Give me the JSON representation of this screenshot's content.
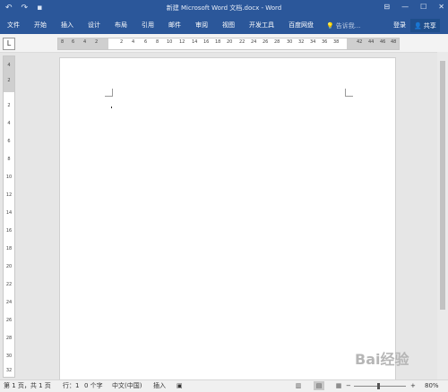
{
  "window": {
    "title": "新建 Microsoft Word 文档.docx - Word",
    "qat": {
      "undo_icon": "↶",
      "redo_icon": "↷",
      "save_icon": "▪"
    },
    "controls": [
      "⊟",
      "—",
      "☐",
      "✕"
    ]
  },
  "ribbon": {
    "tabs": [
      "文件",
      "开始",
      "插入",
      "设计",
      "布局",
      "引用",
      "邮件",
      "审阅",
      "视图",
      "开发工具",
      "百度网盘"
    ],
    "tell_me": {
      "icon": "💡",
      "placeholder": "告诉我..."
    },
    "login": "登录",
    "share": {
      "icon": "👤",
      "label": "共享"
    }
  },
  "toolbar": {
    "tab_stop": "L"
  },
  "ruler": {
    "h_left_ticks": [
      "8",
      "6",
      "4",
      "2"
    ],
    "h_ticks": [
      "2",
      "4",
      "6",
      "8",
      "10",
      "12",
      "14",
      "16",
      "18",
      "20",
      "22",
      "24",
      "26",
      "28",
      "30",
      "32",
      "34",
      "36",
      "38"
    ],
    "h_right_ticks": [
      "42",
      "44",
      "46",
      "48"
    ],
    "v_ticks": [
      "4",
      "2",
      "2",
      "4",
      "6",
      "8",
      "10",
      "12",
      "14",
      "16",
      "18",
      "20",
      "22",
      "24",
      "26",
      "28",
      "30",
      "32"
    ]
  },
  "statusbar": {
    "page": "第 1 页，共 1 页",
    "line": "行：1",
    "words": "0 个字",
    "lang": "中文(中国)",
    "mode": "插入",
    "zoom_minus": "−",
    "zoom_plus": "+",
    "zoom": "80%"
  },
  "watermark": "Bai经验"
}
